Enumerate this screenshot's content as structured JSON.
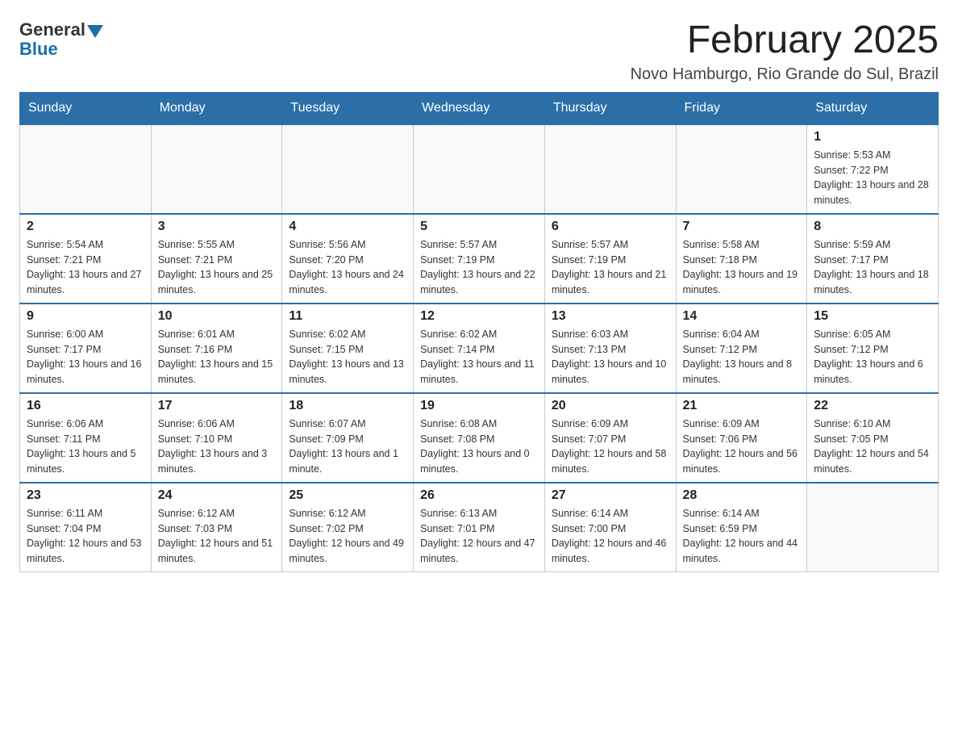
{
  "logo": {
    "general": "General",
    "blue": "Blue"
  },
  "header": {
    "month_year": "February 2025",
    "location": "Novo Hamburgo, Rio Grande do Sul, Brazil"
  },
  "days_of_week": [
    "Sunday",
    "Monday",
    "Tuesday",
    "Wednesday",
    "Thursday",
    "Friday",
    "Saturday"
  ],
  "weeks": [
    [
      {
        "day": "",
        "info": ""
      },
      {
        "day": "",
        "info": ""
      },
      {
        "day": "",
        "info": ""
      },
      {
        "day": "",
        "info": ""
      },
      {
        "day": "",
        "info": ""
      },
      {
        "day": "",
        "info": ""
      },
      {
        "day": "1",
        "info": "Sunrise: 5:53 AM\nSunset: 7:22 PM\nDaylight: 13 hours and 28 minutes."
      }
    ],
    [
      {
        "day": "2",
        "info": "Sunrise: 5:54 AM\nSunset: 7:21 PM\nDaylight: 13 hours and 27 minutes."
      },
      {
        "day": "3",
        "info": "Sunrise: 5:55 AM\nSunset: 7:21 PM\nDaylight: 13 hours and 25 minutes."
      },
      {
        "day": "4",
        "info": "Sunrise: 5:56 AM\nSunset: 7:20 PM\nDaylight: 13 hours and 24 minutes."
      },
      {
        "day": "5",
        "info": "Sunrise: 5:57 AM\nSunset: 7:19 PM\nDaylight: 13 hours and 22 minutes."
      },
      {
        "day": "6",
        "info": "Sunrise: 5:57 AM\nSunset: 7:19 PM\nDaylight: 13 hours and 21 minutes."
      },
      {
        "day": "7",
        "info": "Sunrise: 5:58 AM\nSunset: 7:18 PM\nDaylight: 13 hours and 19 minutes."
      },
      {
        "day": "8",
        "info": "Sunrise: 5:59 AM\nSunset: 7:17 PM\nDaylight: 13 hours and 18 minutes."
      }
    ],
    [
      {
        "day": "9",
        "info": "Sunrise: 6:00 AM\nSunset: 7:17 PM\nDaylight: 13 hours and 16 minutes."
      },
      {
        "day": "10",
        "info": "Sunrise: 6:01 AM\nSunset: 7:16 PM\nDaylight: 13 hours and 15 minutes."
      },
      {
        "day": "11",
        "info": "Sunrise: 6:02 AM\nSunset: 7:15 PM\nDaylight: 13 hours and 13 minutes."
      },
      {
        "day": "12",
        "info": "Sunrise: 6:02 AM\nSunset: 7:14 PM\nDaylight: 13 hours and 11 minutes."
      },
      {
        "day": "13",
        "info": "Sunrise: 6:03 AM\nSunset: 7:13 PM\nDaylight: 13 hours and 10 minutes."
      },
      {
        "day": "14",
        "info": "Sunrise: 6:04 AM\nSunset: 7:12 PM\nDaylight: 13 hours and 8 minutes."
      },
      {
        "day": "15",
        "info": "Sunrise: 6:05 AM\nSunset: 7:12 PM\nDaylight: 13 hours and 6 minutes."
      }
    ],
    [
      {
        "day": "16",
        "info": "Sunrise: 6:06 AM\nSunset: 7:11 PM\nDaylight: 13 hours and 5 minutes."
      },
      {
        "day": "17",
        "info": "Sunrise: 6:06 AM\nSunset: 7:10 PM\nDaylight: 13 hours and 3 minutes."
      },
      {
        "day": "18",
        "info": "Sunrise: 6:07 AM\nSunset: 7:09 PM\nDaylight: 13 hours and 1 minute."
      },
      {
        "day": "19",
        "info": "Sunrise: 6:08 AM\nSunset: 7:08 PM\nDaylight: 13 hours and 0 minutes."
      },
      {
        "day": "20",
        "info": "Sunrise: 6:09 AM\nSunset: 7:07 PM\nDaylight: 12 hours and 58 minutes."
      },
      {
        "day": "21",
        "info": "Sunrise: 6:09 AM\nSunset: 7:06 PM\nDaylight: 12 hours and 56 minutes."
      },
      {
        "day": "22",
        "info": "Sunrise: 6:10 AM\nSunset: 7:05 PM\nDaylight: 12 hours and 54 minutes."
      }
    ],
    [
      {
        "day": "23",
        "info": "Sunrise: 6:11 AM\nSunset: 7:04 PM\nDaylight: 12 hours and 53 minutes."
      },
      {
        "day": "24",
        "info": "Sunrise: 6:12 AM\nSunset: 7:03 PM\nDaylight: 12 hours and 51 minutes."
      },
      {
        "day": "25",
        "info": "Sunrise: 6:12 AM\nSunset: 7:02 PM\nDaylight: 12 hours and 49 minutes."
      },
      {
        "day": "26",
        "info": "Sunrise: 6:13 AM\nSunset: 7:01 PM\nDaylight: 12 hours and 47 minutes."
      },
      {
        "day": "27",
        "info": "Sunrise: 6:14 AM\nSunset: 7:00 PM\nDaylight: 12 hours and 46 minutes."
      },
      {
        "day": "28",
        "info": "Sunrise: 6:14 AM\nSunset: 6:59 PM\nDaylight: 12 hours and 44 minutes."
      },
      {
        "day": "",
        "info": ""
      }
    ]
  ]
}
